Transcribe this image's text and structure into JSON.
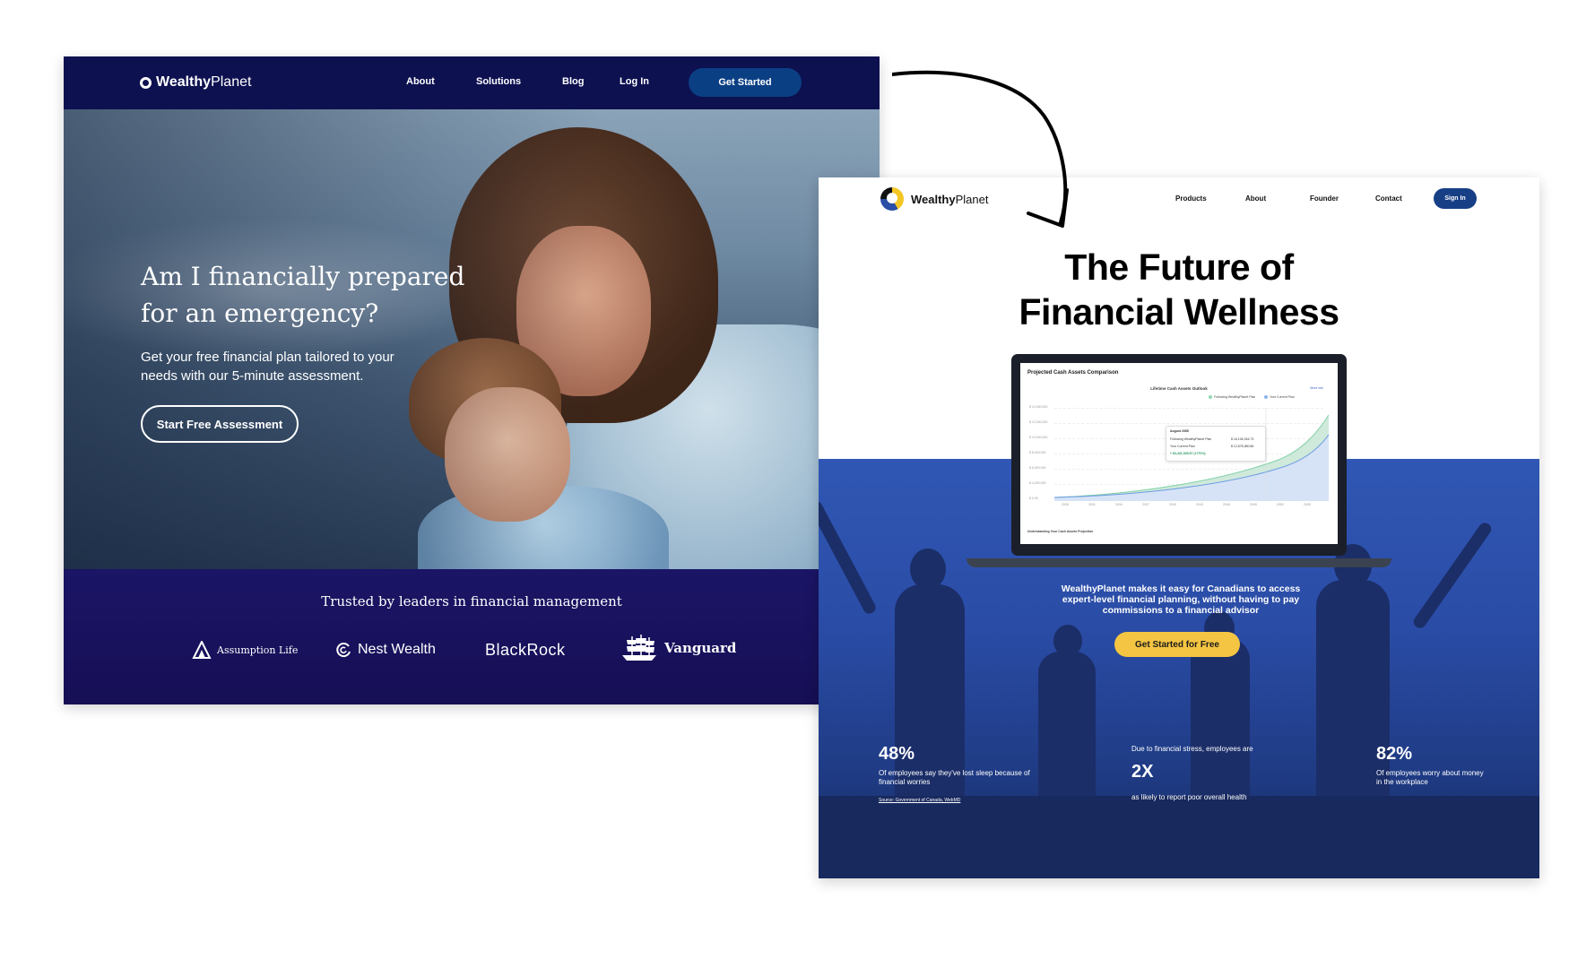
{
  "old_site": {
    "logo": {
      "bold": "Wealthy",
      "regular": "Planet"
    },
    "nav": [
      "About",
      "Solutions",
      "Blog",
      "Log In"
    ],
    "cta": "Get Started",
    "hero": {
      "headline_line1": "Am I financially prepared",
      "headline_line2": "for an emergency?",
      "subtext_line1": "Get your free financial plan tailored to your",
      "subtext_line2": "needs with our 5-minute assessment.",
      "button": "Start Free Assessment"
    },
    "trust": {
      "title": "Trusted by leaders in financial management",
      "brands": [
        "Assumption Life",
        "Nest Wealth",
        "BlackRock",
        "Vanguard"
      ]
    }
  },
  "new_site": {
    "logo": {
      "bold": "Wealthy",
      "regular": "Planet"
    },
    "nav": [
      "Products",
      "About",
      "Founder",
      "Contact"
    ],
    "signin": "Sign In",
    "headline_line1": "The Future of",
    "headline_line2": "Financial Wellness",
    "dashboard": {
      "title": "Projected Cash Assets Comparison",
      "chart_title": "Lifetime Cash Assets Outlook",
      "more_info": "More info",
      "legend": [
        "Following WealthyPlanet Plan",
        "Your Current Plan"
      ],
      "y_ticks": [
        "$ 14,000,000",
        "$ 12,000,000",
        "$ 10,000,000",
        "$ 8,000,000",
        "$ 6,000,000",
        "$ 4,000,000",
        "$ 0.00"
      ],
      "x_ticks": [
        "2028",
        "2031",
        "2034",
        "2037",
        "2040",
        "2043",
        "2046",
        "2049",
        "2052",
        "2055"
      ],
      "tooltip": {
        "date": "August 2085",
        "row1_label": "Following WealthyPlanet Plan",
        "row1_value": "$ 16,106,316.73",
        "row2_label": "Your Current Plan",
        "row2_value": "$ 12,678,380.86",
        "diff": "+ $3,431,935.87 (1770%)"
      },
      "footer": "Understanding Your Cash Assets Projection"
    },
    "copy_line1": "WealthyPlanet makes it easy for Canadians to access",
    "copy_line2": "expert-level financial planning, without having to pay",
    "copy_line3": "commissions to a financial advisor",
    "cta": "Get Started for Free",
    "stats": {
      "s1_value": "48%",
      "s1_text_line1": "Of employees say they've lost sleep because of",
      "s1_text_line2": "financial worries",
      "source": "Source: Government of Canada, WebMD",
      "s2_pre": "Due to financial stress, employees are",
      "s2_value": "2X",
      "s2_text": "as likely to report poor overall health",
      "s3_value": "82%",
      "s3_text_line1": "Of employees worry about money",
      "s3_text_line2": "in the workplace"
    }
  },
  "colors": {
    "old_nav": "#0d1150",
    "old_cta": "#0b3f84",
    "old_trust": "#1b1566",
    "new_blue": "#2a4ca6",
    "new_signin": "#163f86",
    "new_cta": "#f4c542",
    "chart_green": "#a8e3c4",
    "chart_blue": "#8fb3ea"
  }
}
